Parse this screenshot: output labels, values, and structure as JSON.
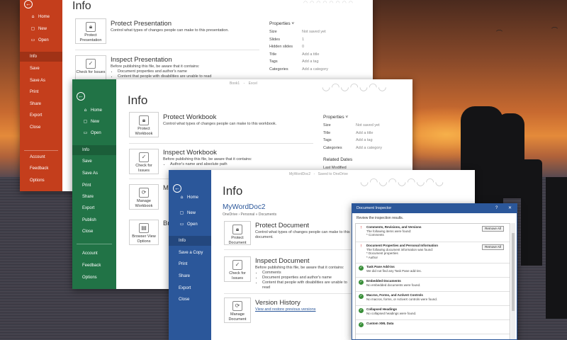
{
  "colors": {
    "powerpoint": "#c43e1c",
    "excel": "#217346",
    "word": "#2b579a"
  },
  "powerpoint": {
    "title": "Info",
    "sidebar": [
      {
        "icon": "home-icon",
        "glyph": "⌂",
        "label": "Home"
      },
      {
        "icon": "new-icon",
        "glyph": "▢",
        "label": "New"
      },
      {
        "icon": "open-icon",
        "glyph": "▭",
        "label": "Open"
      },
      {
        "icon": "",
        "glyph": "",
        "label": "Info"
      },
      {
        "icon": "",
        "glyph": "",
        "label": "Save"
      },
      {
        "icon": "",
        "glyph": "",
        "label": "Save As"
      },
      {
        "icon": "",
        "glyph": "",
        "label": "Print"
      },
      {
        "icon": "",
        "glyph": "",
        "label": "Share"
      },
      {
        "icon": "",
        "glyph": "",
        "label": "Export"
      },
      {
        "icon": "",
        "glyph": "",
        "label": "Close"
      },
      {
        "icon": "",
        "glyph": "",
        "label": "Account"
      },
      {
        "icon": "",
        "glyph": "",
        "label": "Feedback"
      },
      {
        "icon": "",
        "glyph": "",
        "label": "Options"
      }
    ],
    "protect": {
      "button": "Protect Presentation",
      "heading": "Protect Presentation",
      "desc": "Control what types of changes people can make to this presentation."
    },
    "inspect": {
      "button": "Check for Issues",
      "heading": "Inspect Presentation",
      "desc": "Before publishing this file, be aware that it contains:",
      "items": [
        "Document properties and author's name",
        "Content that people with disabilities are unable to read"
      ]
    },
    "properties": {
      "heading": "Properties",
      "rows": [
        {
          "label": "Size",
          "value": "Not saved yet"
        },
        {
          "label": "Slides",
          "value": "1"
        },
        {
          "label": "Hidden slides",
          "value": "0"
        },
        {
          "label": "Title",
          "value": "Add a title"
        },
        {
          "label": "Tags",
          "value": "Add a tag"
        },
        {
          "label": "Categories",
          "value": "Add a category"
        }
      ]
    }
  },
  "excel": {
    "title": "Info",
    "topbar": [
      "Book1",
      "Excel"
    ],
    "sidebar": [
      {
        "icon": "home-icon",
        "glyph": "⌂",
        "label": "Home"
      },
      {
        "icon": "new-icon",
        "glyph": "▢",
        "label": "New"
      },
      {
        "icon": "open-icon",
        "glyph": "▭",
        "label": "Open"
      },
      {
        "icon": "",
        "glyph": "",
        "label": "Info"
      },
      {
        "icon": "",
        "glyph": "",
        "label": "Save"
      },
      {
        "icon": "",
        "glyph": "",
        "label": "Save As"
      },
      {
        "icon": "",
        "glyph": "",
        "label": "Print"
      },
      {
        "icon": "",
        "glyph": "",
        "label": "Share"
      },
      {
        "icon": "",
        "glyph": "",
        "label": "Export"
      },
      {
        "icon": "",
        "glyph": "",
        "label": "Publish"
      },
      {
        "icon": "",
        "glyph": "",
        "label": "Close"
      },
      {
        "icon": "",
        "glyph": "",
        "label": "Account"
      },
      {
        "icon": "",
        "glyph": "",
        "label": "Feedback"
      },
      {
        "icon": "",
        "glyph": "",
        "label": "Options"
      }
    ],
    "protect": {
      "button": "Protect Workbook",
      "heading": "Protect Workbook",
      "desc": "Control what types of changes people can make to this workbook."
    },
    "inspect": {
      "button": "Check for Issues",
      "heading": "Inspect Workbook",
      "desc": "Before publishing this file, be aware that it contains:",
      "items": [
        "Author's name and absolute path"
      ]
    },
    "manage": {
      "button": "Manage Workbook",
      "heading": "M"
    },
    "browser": {
      "button": "Browser View Options",
      "heading": "Br"
    },
    "properties": {
      "heading": "Properties",
      "rows": [
        {
          "label": "Size",
          "value": "Not saved yet"
        },
        {
          "label": "Title",
          "value": "Add a title"
        },
        {
          "label": "Tags",
          "value": "Add a tag"
        },
        {
          "label": "Categories",
          "value": "Add a category"
        }
      ]
    },
    "related": {
      "heading": "Related Dates",
      "last_modified": "Last Modified"
    }
  },
  "word": {
    "title": "Info",
    "topbar": [
      "MyWordDoc2",
      "Saved to OneDrive"
    ],
    "doc_name": "MyWordDoc2",
    "path": "OneDrive › Personal » Documents",
    "sidebar": [
      {
        "icon": "home-icon",
        "glyph": "⌂",
        "label": "Home"
      },
      {
        "icon": "new-icon",
        "glyph": "▢",
        "label": "New"
      },
      {
        "icon": "open-icon",
        "glyph": "▭",
        "label": "Open"
      },
      {
        "icon": "",
        "glyph": "",
        "label": "Info"
      },
      {
        "icon": "",
        "glyph": "",
        "label": "Save a Copy"
      },
      {
        "icon": "",
        "glyph": "",
        "label": "Print"
      },
      {
        "icon": "",
        "glyph": "",
        "label": "Share"
      },
      {
        "icon": "",
        "glyph": "",
        "label": "Export"
      },
      {
        "icon": "",
        "glyph": "",
        "label": "Close"
      }
    ],
    "protect": {
      "button": "Protect Document",
      "heading": "Protect Document",
      "desc": "Control what types of changes people can make to this document."
    },
    "inspect": {
      "button": "Check for Issues",
      "heading": "Inspect Document",
      "desc": "Before publishing this file, be aware that it contains:",
      "items": [
        "Comments",
        "Document properties and author's name",
        "Content that people with disabilities are unable to read"
      ]
    },
    "version": {
      "button": "Manage Document",
      "heading": "Version History",
      "link": "View and restore previous versions"
    }
  },
  "inspector": {
    "title": "Document Inspector",
    "help": "?",
    "close": "✕",
    "intro": "Review the inspection results.",
    "entries": [
      {
        "status": "found",
        "name": "Comments, Revisions, and Versions",
        "lines": [
          "The following items were found:",
          "* Comments"
        ],
        "button": "Remove All"
      },
      {
        "status": "found",
        "name": "Document Properties and Personal Information",
        "lines": [
          "The following document information was found:",
          "* Document properties",
          "* Author"
        ],
        "button": "Remove All"
      },
      {
        "status": "ok",
        "name": "Task Pane Add-ins",
        "lines": [
          "We did not find any Task Pane add-ins."
        ],
        "button": ""
      },
      {
        "status": "ok",
        "name": "Embedded Documents",
        "lines": [
          "No embedded documents were found."
        ],
        "button": ""
      },
      {
        "status": "ok",
        "name": "Macros, Forms, and ActiveX Controls",
        "lines": [
          "No macros, forms, or ActiveX controls were found."
        ],
        "button": ""
      },
      {
        "status": "ok",
        "name": "Collapsed Headings",
        "lines": [
          "No collapsed headings were found."
        ],
        "button": ""
      },
      {
        "status": "ok",
        "name": "Custom XML Data",
        "lines": [
          ""
        ],
        "button": ""
      }
    ]
  }
}
